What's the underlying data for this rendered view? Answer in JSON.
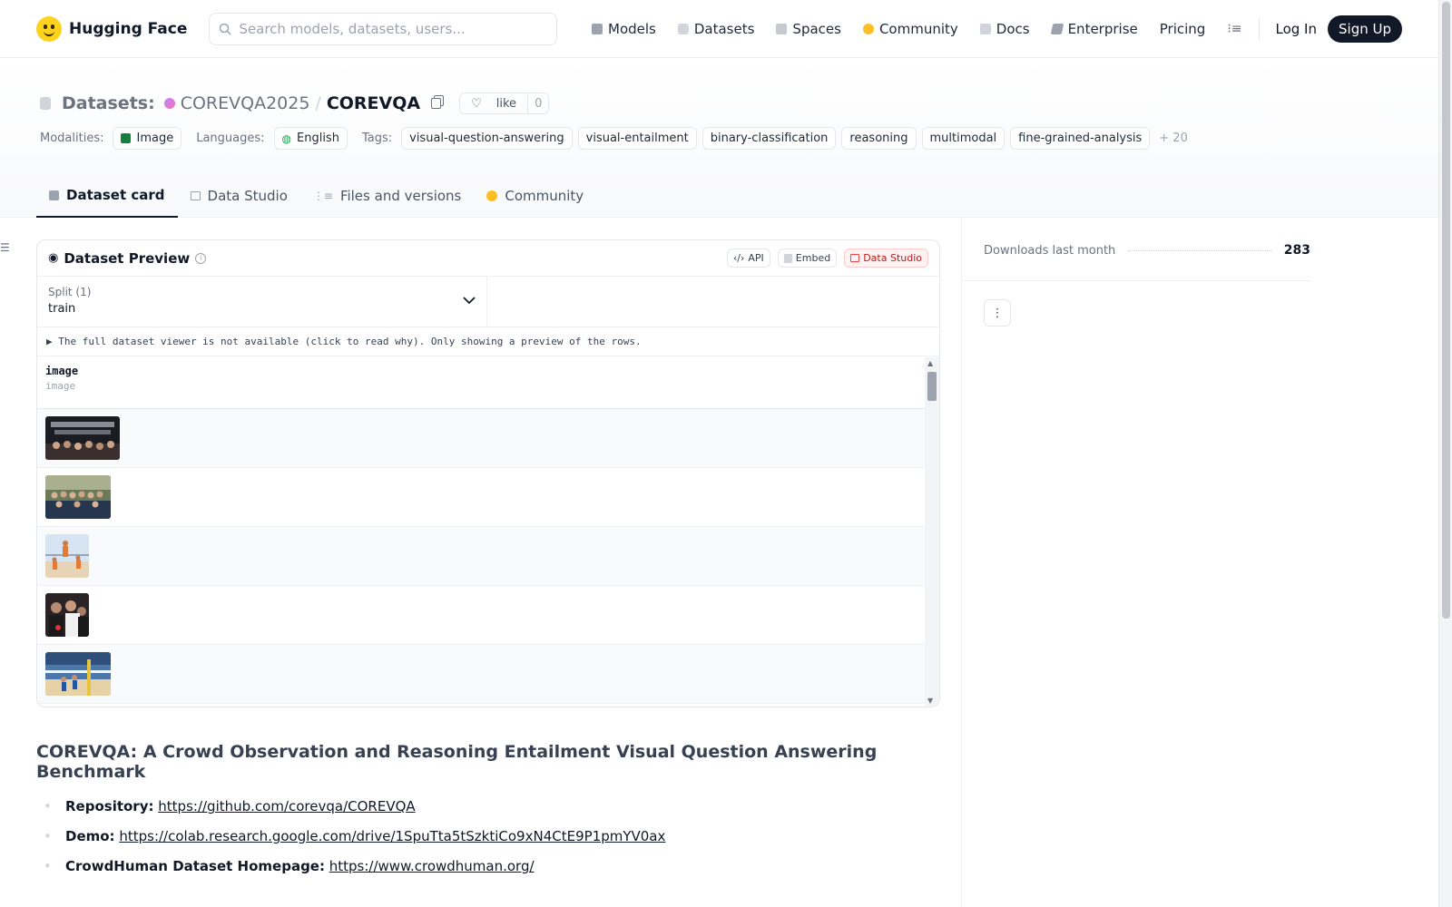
{
  "header": {
    "brand": "Hugging Face",
    "search_placeholder": "Search models, datasets, users...",
    "nav": [
      {
        "label": "Models",
        "icon": "cube-icon",
        "color": "#6b7280"
      },
      {
        "label": "Datasets",
        "icon": "database-icon",
        "color": "#9ca3af"
      },
      {
        "label": "Spaces",
        "icon": "grid-icon",
        "color": "#9ca3af"
      },
      {
        "label": "Community",
        "icon": "hugging-face-icon",
        "color": "#fbbf24"
      },
      {
        "label": "Docs",
        "icon": "book-icon",
        "color": "#9ca3af"
      },
      {
        "label": "Enterprise",
        "icon": "enterprise-icon",
        "color": "#6b7280"
      },
      {
        "label": "Pricing",
        "icon": "",
        "color": ""
      }
    ],
    "login": "Log In",
    "signup": "Sign Up"
  },
  "repo": {
    "type_label": "Datasets:",
    "org": "COREVQA2025",
    "name": "COREVQA",
    "like_label": "like",
    "like_count": "0"
  },
  "meta": {
    "modalities_label": "Modalities:",
    "modality": "Image",
    "languages_label": "Languages:",
    "language": "English",
    "tags_label": "Tags:",
    "tags": [
      "visual-question-answering",
      "visual-entailment",
      "binary-classification",
      "reasoning",
      "multimodal",
      "fine-grained-analysis"
    ],
    "more_tags": "+ 20"
  },
  "tabs": [
    {
      "label": "Dataset card",
      "icon": "card-icon",
      "active": true
    },
    {
      "label": "Data Studio",
      "icon": "table-icon",
      "active": false
    },
    {
      "label": "Files and versions",
      "icon": "files-icon",
      "active": false
    },
    {
      "label": "Community",
      "icon": "hugging-face-icon",
      "active": false
    }
  ],
  "preview": {
    "title": "Dataset Preview",
    "api": "API",
    "embed": "Embed",
    "data_studio": "Data Studio",
    "split_label": "Split (1)",
    "split_value": "train",
    "notice": "▶ The full dataset viewer is not available (click to read why). Only showing a preview of the rows.",
    "column_name": "image",
    "column_type": "image"
  },
  "content": {
    "heading": "COREVQA: A Crowd Observation and Reasoning Entailment Visual Question Answering Benchmark",
    "links": [
      {
        "label": "Repository:",
        "url": "https://github.com/corevqa/COREVQA"
      },
      {
        "label": "Demo:",
        "url": "https://colab.research.google.com/drive/1SpuTta5tSzktiCo9xN4CtE9P1pmYV0ax"
      },
      {
        "label": "CrowdHuman Dataset Homepage:",
        "url": "https://www.crowdhuman.org/"
      }
    ]
  },
  "sidebar": {
    "downloads_label": "Downloads last month",
    "downloads_value": "283"
  }
}
